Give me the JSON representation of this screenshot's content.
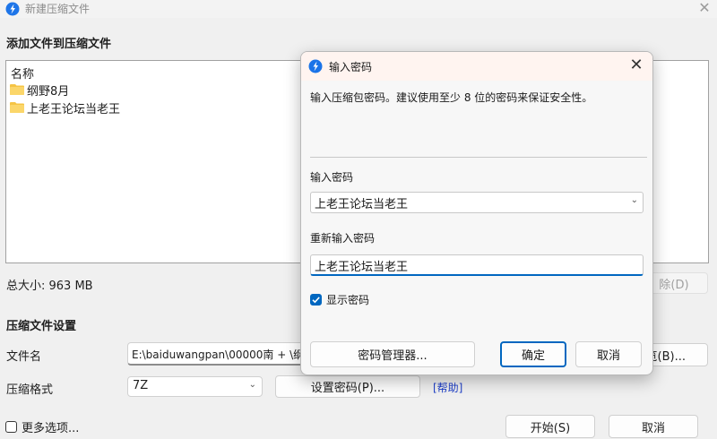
{
  "window": {
    "title": "新建压缩文件",
    "close_glyph": "✕",
    "logo_icon": "bandizip-logo-icon"
  },
  "add_section": {
    "heading": "添加文件到压缩文件",
    "list_header": "名称",
    "files": [
      {
        "name": "纲野8月",
        "icon": "folder-icon"
      },
      {
        "name": "上老王论坛当老王",
        "icon": "folder-icon"
      }
    ],
    "total_size": "总大小: 963 MB",
    "delete_button": "除(D)"
  },
  "settings": {
    "heading": "压缩文件设置",
    "filename_label": "文件名",
    "filename_value": "E:\\baiduwangpan\\00000南 + \\纲",
    "browse_button": "览(B)...",
    "format_label": "压缩格式",
    "format_value": "7Z",
    "set_password_button": "设置密码(P)...",
    "help_link": "[帮助]"
  },
  "footer": {
    "more_options": "更多选项...",
    "start_button": "开始(S)",
    "cancel_button": "取消"
  },
  "password_dialog": {
    "title": "输入密码",
    "close_glyph": "✕",
    "hint": "输入压缩包密码。建议使用至少 8 位的密码来保证安全性。",
    "password_label": "输入密码",
    "password_value": "上老王论坛当老王",
    "confirm_label": "重新输入密码",
    "confirm_value": "上老王论坛当老王",
    "show_password_label": "显示密码",
    "show_password_checked": true,
    "manager_button": "密码管理器...",
    "ok_button": "确定",
    "cancel_button": "取消"
  },
  "colors": {
    "accent": "#0067c0",
    "logo": "#1a73e8",
    "folder": "#f5c342",
    "link": "#1a3cc8"
  }
}
